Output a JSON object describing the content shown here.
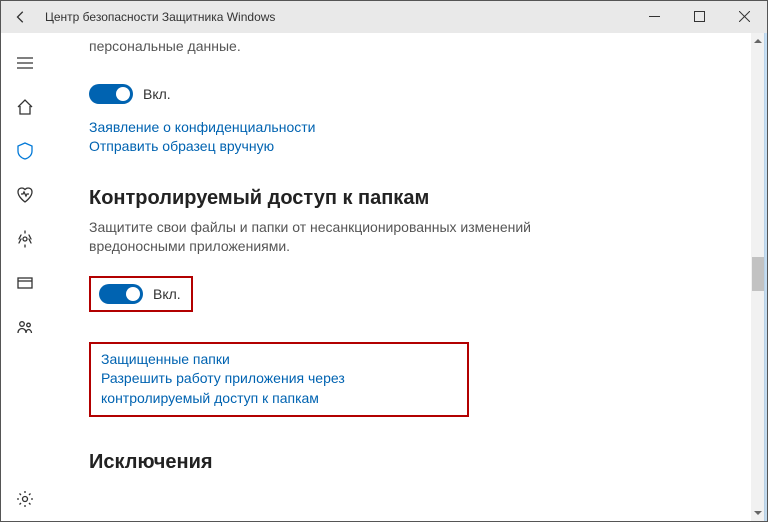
{
  "window": {
    "title": "Центр безопасности Защитника Windows"
  },
  "top_section": {
    "trailing_text": "персональные данные.",
    "toggle_label": "Вкл.",
    "link_privacy": "Заявление о конфиденциальности",
    "link_submit": "Отправить образец вручную"
  },
  "cfa": {
    "title": "Контролируемый доступ к папкам",
    "desc": "Защитите свои файлы и папки от несанкционированных изменений вредоносными приложениями.",
    "toggle_label": "Вкл.",
    "link_protected": "Защищенные папки",
    "link_allow": "Разрешить работу приложения через контролируемый доступ к папкам"
  },
  "exclusions": {
    "title": "Исключения"
  }
}
